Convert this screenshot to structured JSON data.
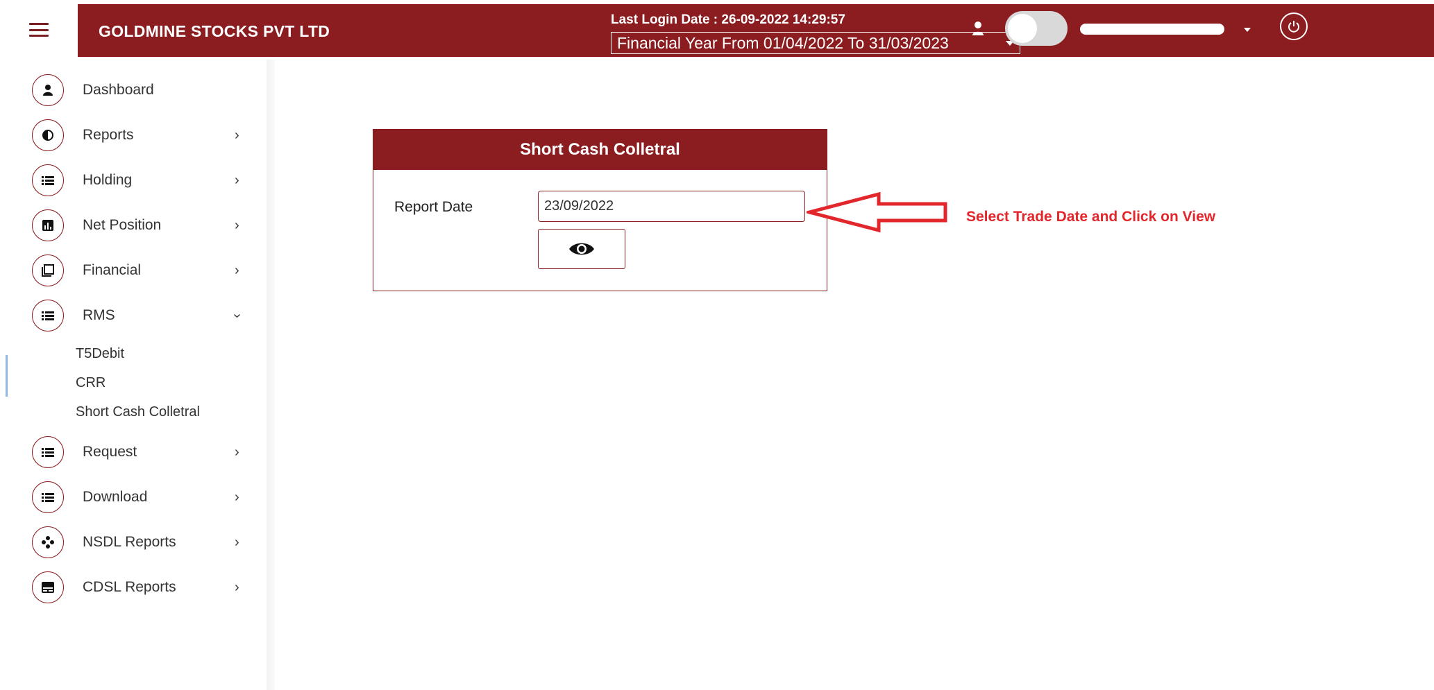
{
  "header": {
    "brand": "GOLDMINE STOCKS PVT LTD",
    "last_login": "Last Login Date : 26-09-2022 14:29:57",
    "financial_year": "Financial Year From 01/04/2022 To 31/03/2023"
  },
  "sidebar": {
    "items": [
      {
        "label": "Dashboard",
        "icon": "user-icon"
      },
      {
        "label": "Reports",
        "icon": "contrast-icon"
      },
      {
        "label": "Holding",
        "icon": "list-icon"
      },
      {
        "label": "Net Position",
        "icon": "bar-chart-icon"
      },
      {
        "label": "Financial",
        "icon": "copy-icon"
      },
      {
        "label": "RMS",
        "icon": "list-icon"
      },
      {
        "label": "Request",
        "icon": "list-icon"
      },
      {
        "label": "Download",
        "icon": "list-icon"
      },
      {
        "label": "NSDL Reports",
        "icon": "gamepad-icon"
      },
      {
        "label": "CDSL Reports",
        "icon": "card-icon"
      }
    ],
    "rms_subitems": [
      "T5Debit",
      "CRR",
      "Short Cash Colletral"
    ]
  },
  "card": {
    "title": "Short Cash Colletral",
    "report_date_label": "Report Date",
    "report_date_value": "23/09/2022",
    "view_icon": "eye-icon"
  },
  "annotation": {
    "text": "Select Trade Date and Click on View",
    "color": "#e3262b"
  },
  "colors": {
    "brand": "#8b1d20"
  }
}
